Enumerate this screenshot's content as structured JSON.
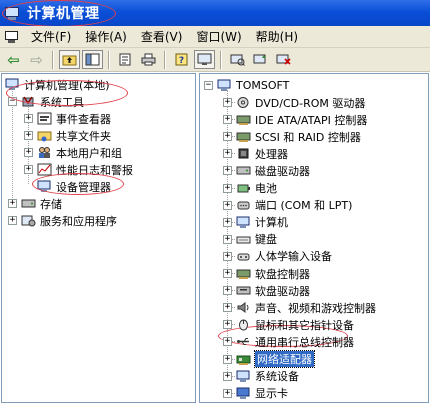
{
  "window": {
    "title": "计算机管理"
  },
  "menu": [
    {
      "label": "文件(F)"
    },
    {
      "label": "操作(A)"
    },
    {
      "label": "查看(V)"
    },
    {
      "label": "窗口(W)"
    },
    {
      "label": "帮助(H)"
    }
  ],
  "left_tree": {
    "root": "计算机管理(本地)",
    "system_tools": "系统工具",
    "event_viewer": "事件查看器",
    "shared_folders": "共享文件夹",
    "local_users": "本地用户和组",
    "perf_logs": "性能日志和警报",
    "device_manager": "设备管理器",
    "storage": "存储",
    "services_apps": "服务和应用程序"
  },
  "right_tree": {
    "root": "TOMSOFT",
    "items": [
      {
        "label": "DVD/CD-ROM 驱动器",
        "icon": "cdrom-icon"
      },
      {
        "label": "IDE ATA/ATAPI 控制器",
        "icon": "ide-controller-icon"
      },
      {
        "label": "SCSI 和 RAID 控制器",
        "icon": "scsi-controller-icon"
      },
      {
        "label": "处理器",
        "icon": "processor-icon"
      },
      {
        "label": "磁盘驱动器",
        "icon": "disk-drive-icon"
      },
      {
        "label": "电池",
        "icon": "battery-icon"
      },
      {
        "label": "端口 (COM 和 LPT)",
        "icon": "port-icon"
      },
      {
        "label": "计算机",
        "icon": "computer-icon"
      },
      {
        "label": "键盘",
        "icon": "keyboard-icon"
      },
      {
        "label": "人体学输入设备",
        "icon": "hid-icon"
      },
      {
        "label": "软盘控制器",
        "icon": "floppy-controller-icon"
      },
      {
        "label": "软盘驱动器",
        "icon": "floppy-drive-icon"
      },
      {
        "label": "声音、视频和游戏控制器",
        "icon": "sound-icon"
      },
      {
        "label": "鼠标和其它指针设备",
        "icon": "mouse-icon"
      },
      {
        "label": "通用串行总线控制器",
        "icon": "usb-icon"
      },
      {
        "label": "网络适配器",
        "icon": "network-adapter-icon"
      },
      {
        "label": "系统设备",
        "icon": "system-device-icon"
      },
      {
        "label": "显示卡",
        "icon": "display-adapter-icon"
      }
    ]
  },
  "colors": {
    "titlebar": "#0a4fd8",
    "selection": "#316ac5",
    "annotation": "#e0404a"
  }
}
